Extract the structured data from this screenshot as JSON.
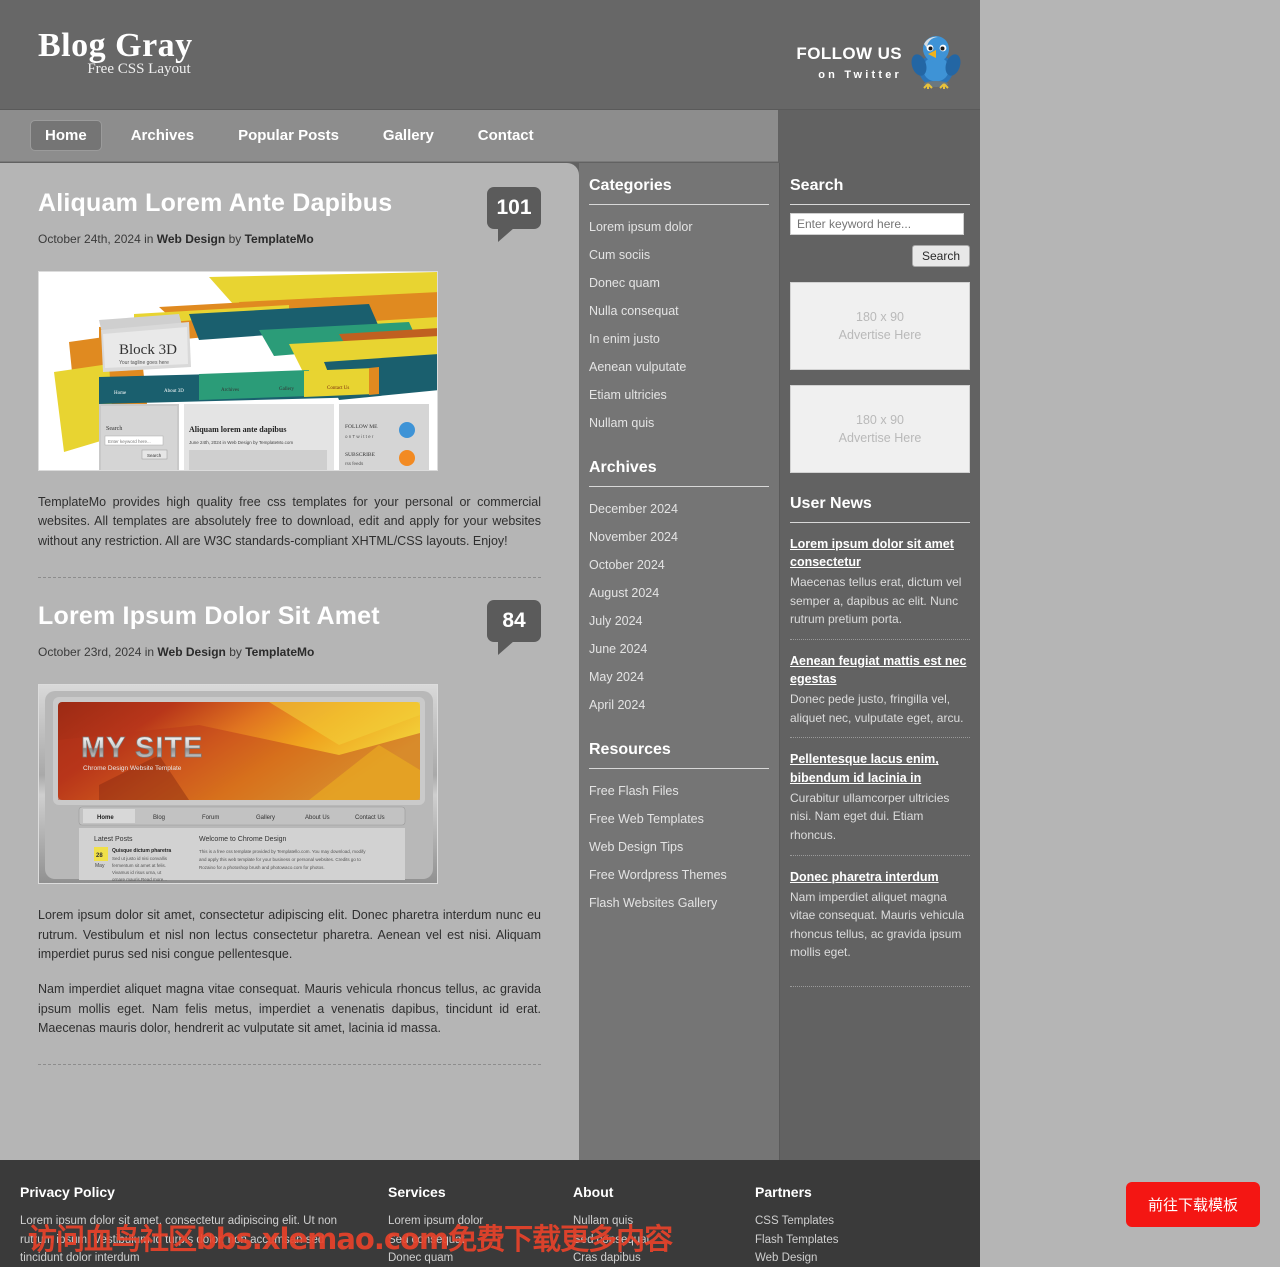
{
  "header": {
    "brand_title": "Blog Gray",
    "brand_subtitle": "Free CSS Layout",
    "follow_main": "FOLLOW US",
    "follow_sub": "on Twitter"
  },
  "nav": {
    "items": [
      {
        "label": "Home",
        "active": true
      },
      {
        "label": "Archives",
        "active": false
      },
      {
        "label": "Popular Posts",
        "active": false
      },
      {
        "label": "Gallery",
        "active": false
      },
      {
        "label": "Contact",
        "active": false
      }
    ]
  },
  "posts": [
    {
      "title": "Aliquam Lorem Ante Dapibus",
      "date": "October 24th, 2024",
      "in_word": " in ",
      "category": "Web Design",
      "by_word": " by ",
      "author": "TemplateMo",
      "comments": "101",
      "thumb_title": "Block 3D",
      "thumb_tagline": "Your tagline goes here",
      "body": [
        "TemplateMo provides high quality free css templates for your personal or commercial websites. All templates are absolutely free to download, edit and apply for your websites without any restriction. All are W3C standards-compliant XHTML/CSS layouts. Enjoy!"
      ]
    },
    {
      "title": "Lorem Ipsum Dolor Sit Amet",
      "date": "October 23rd, 2024",
      "in_word": " in ",
      "category": "Web Design",
      "by_word": " by ",
      "author": "TemplateMo",
      "comments": "84",
      "thumb_title": "MY SITE",
      "thumb_tagline": "Chrome Design Website Template",
      "body": [
        "Lorem ipsum dolor sit amet, consectetur adipiscing elit. Donec pharetra interdum nunc eu rutrum. Vestibulum et nisl non lectus consectetur pharetra. Aenean vel est nisi. Aliquam imperdiet purus sed nisi congue pellentesque.",
        "Nam imperdiet aliquet magna vitae consequat. Mauris vehicula rhoncus tellus, ac gravida ipsum mollis eget. Nam felis metus, imperdiet a venenatis dapibus, tincidunt id erat. Maecenas mauris dolor, hendrerit ac vulputate sit amet, lacinia id massa."
      ]
    }
  ],
  "sidebar_left": {
    "categories_title": "Categories",
    "categories": [
      "Lorem ipsum dolor",
      "Cum sociis",
      "Donec quam",
      "Nulla consequat",
      "In enim justo",
      "Aenean vulputate",
      "Etiam ultricies",
      "Nullam quis"
    ],
    "archives_title": "Archives",
    "archives": [
      "December 2024",
      "November 2024",
      "October 2024",
      "August 2024",
      "July 2024",
      "June 2024",
      "May 2024",
      "April 2024"
    ],
    "resources_title": "Resources",
    "resources": [
      "Free Flash Files",
      "Free Web Templates",
      "Web Design Tips",
      "Free Wordpress Themes",
      "Flash Websites Gallery"
    ]
  },
  "sidebar_right": {
    "search_title": "Search",
    "search_placeholder": "Enter keyword here...",
    "search_button": "Search",
    "ads": [
      {
        "size": "180 x 90",
        "text": "Advertise Here"
      },
      {
        "size": "180 x 90",
        "text": "Advertise Here"
      }
    ],
    "news_title": "User News",
    "news": [
      {
        "title": "Lorem ipsum dolor sit amet consectetur",
        "text": "Maecenas tellus erat, dictum vel semper a, dapibus ac elit. Nunc rutrum pretium porta."
      },
      {
        "title": "Aenean feugiat mattis est nec egestas",
        "text": "Donec pede justo, fringilla vel, aliquet nec, vulputate eget, arcu."
      },
      {
        "title": "Pellentesque lacus enim, bibendum id lacinia in",
        "text": "Curabitur ullamcorper ultricies nisi. Nam eget dui. Etiam rhoncus."
      },
      {
        "title": "Donec pharetra interdum",
        "text": "Nam imperdiet aliquet magna vitae consequat. Mauris vehicula rhoncus tellus, ac gravida ipsum mollis eget."
      }
    ]
  },
  "footer": {
    "privacy_title": "Privacy Policy",
    "privacy_text": "Lorem ipsum dolor sit amet, consectetur adipiscing elit. Ut non rutrum ipsum. Vestibulum id turpis dolor, non accumsan sed tincidunt dolor interdum",
    "services_title": "Services",
    "services": [
      "Lorem ipsum dolor",
      "Sed consequat",
      "Donec quam"
    ],
    "about_title": "About",
    "about": [
      "Nullam quis",
      "Sed consequat",
      "Cras dapibus"
    ],
    "partners_title": "Partners",
    "partners": [
      "CSS Templates",
      "Flash Templates",
      "Web Design"
    ]
  },
  "overlay": {
    "watermark": "访问血鸟社区bbs.xlemao.com免费下载更多内容",
    "download_button": "前往下载模板"
  },
  "colors": {
    "page_bg": "#b5b5b5",
    "header_bg": "#676767",
    "nav_bg": "#8d8d8d",
    "sidebar1_bg": "#757575",
    "sidebar2_bg": "#626262",
    "footer_bg": "#3a3a3a",
    "accent_red": "#f41613",
    "watermark_red": "#e8422a"
  }
}
